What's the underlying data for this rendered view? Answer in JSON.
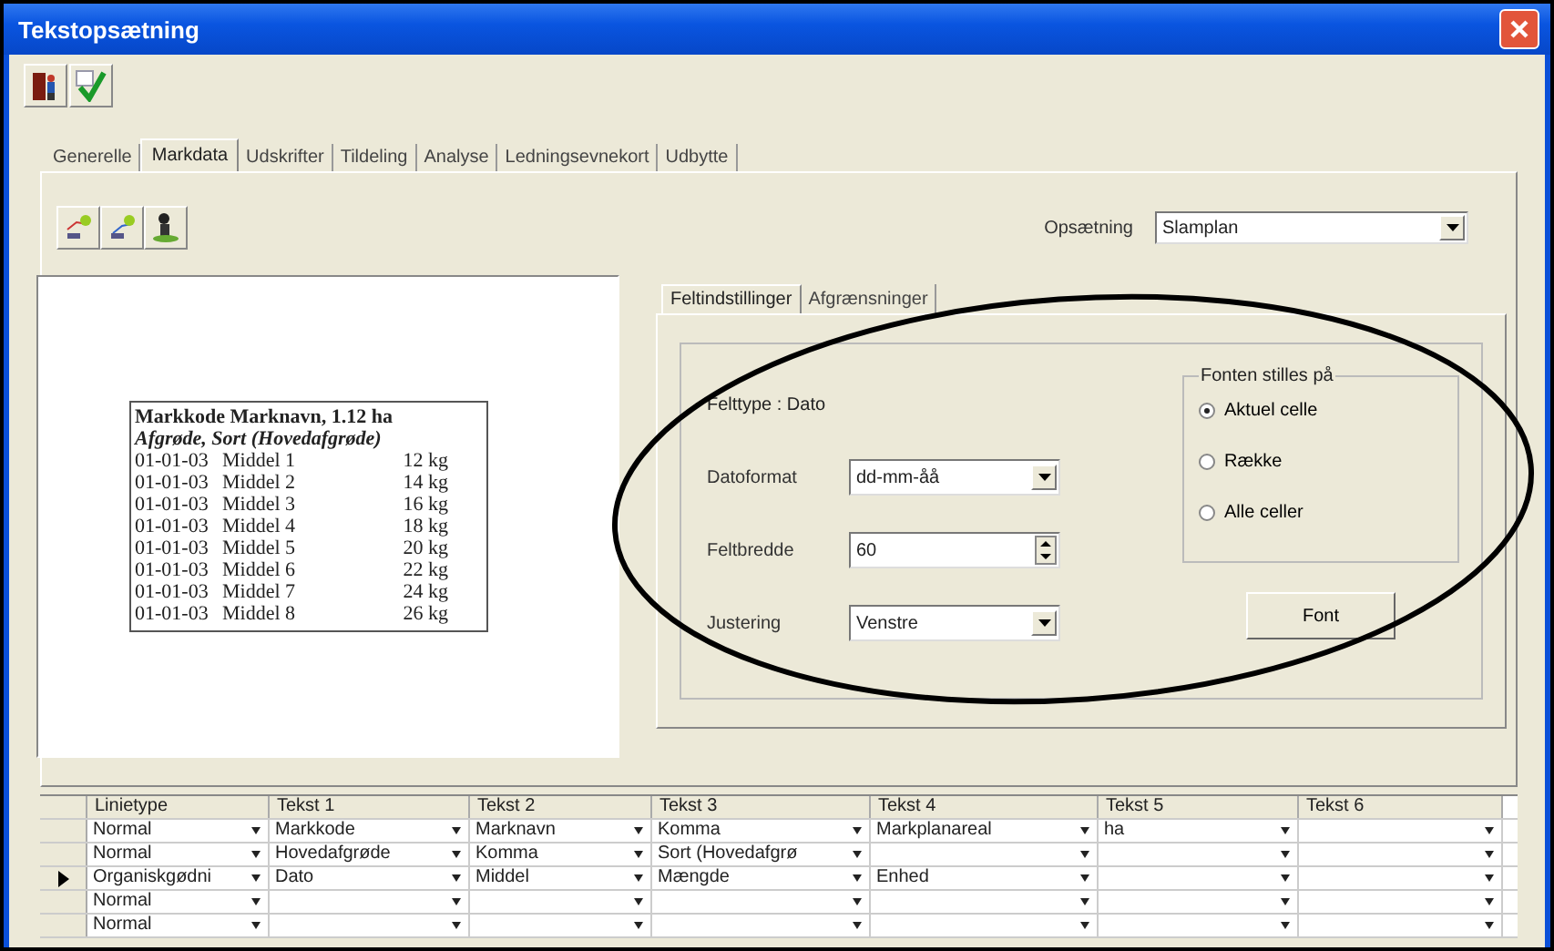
{
  "window": {
    "title": "Tekstopsætning"
  },
  "tabs": [
    {
      "label": "Generelle",
      "selected": false
    },
    {
      "label": "Markdata",
      "selected": true
    },
    {
      "label": "Udskrifter",
      "selected": false
    },
    {
      "label": "Tildeling",
      "selected": false
    },
    {
      "label": "Analyse",
      "selected": false
    },
    {
      "label": "Ledningsevnekort",
      "selected": false
    },
    {
      "label": "Udbytte",
      "selected": false
    }
  ],
  "setup": {
    "label": "Opsætning",
    "value": "Slamplan"
  },
  "preview": {
    "heading": "Markkode Marknavn, 1.12 ha",
    "subheading": "Afgrøde, Sort (Hovedafgrøde)",
    "rows": [
      {
        "date": "01-01-03",
        "name": "Middel 1",
        "amount": "12 kg"
      },
      {
        "date": "01-01-03",
        "name": "Middel 2",
        "amount": "14 kg"
      },
      {
        "date": "01-01-03",
        "name": "Middel 3",
        "amount": "16 kg"
      },
      {
        "date": "01-01-03",
        "name": "Middel 4",
        "amount": "18 kg"
      },
      {
        "date": "01-01-03",
        "name": "Middel 5",
        "amount": "20 kg"
      },
      {
        "date": "01-01-03",
        "name": "Middel 6",
        "amount": "22 kg"
      },
      {
        "date": "01-01-03",
        "name": "Middel 7",
        "amount": "24 kg"
      },
      {
        "date": "01-01-03",
        "name": "Middel 8",
        "amount": "26 kg"
      }
    ]
  },
  "subtabs": [
    {
      "label": "Feltindstillinger",
      "selected": true
    },
    {
      "label": "Afgrænsninger",
      "selected": false
    }
  ],
  "field_settings": {
    "field_type": "Felttype : Dato",
    "fields": [
      {
        "kind": "combo",
        "label": "Datoformat",
        "value": "dd-mm-åå"
      },
      {
        "kind": "spin",
        "label": "Feltbredde",
        "value": "60"
      },
      {
        "kind": "combo",
        "label": "Justering",
        "value": "Venstre"
      }
    ],
    "font_group": {
      "title": "Fonten stilles på",
      "options": [
        {
          "label": "Aktuel celle",
          "selected": true
        },
        {
          "label": "Række",
          "selected": false
        },
        {
          "label": "Alle celler",
          "selected": false
        }
      ]
    },
    "font_button": "Font"
  },
  "grid": {
    "columns": [
      "Linietype",
      "Tekst 1",
      "Tekst 2",
      "Tekst 3",
      "Tekst 4",
      "Tekst 5",
      "Tekst 6"
    ],
    "rows": [
      {
        "current": false,
        "cells": [
          "Normal",
          "Markkode",
          "Marknavn",
          "Komma",
          "Markplanareal",
          "ha",
          ""
        ]
      },
      {
        "current": false,
        "cells": [
          "Normal",
          "Hovedafgrøde",
          "Komma",
          "Sort (Hovedafgrø",
          "",
          "",
          ""
        ]
      },
      {
        "current": true,
        "cells": [
          "Organiskgødni",
          "Dato",
          "Middel",
          "Mængde",
          "Enhed",
          "",
          ""
        ]
      },
      {
        "current": false,
        "cells": [
          "Normal",
          "",
          "",
          "",
          "",
          "",
          ""
        ]
      },
      {
        "current": false,
        "cells": [
          "Normal",
          "",
          "",
          "",
          "",
          "",
          ""
        ]
      }
    ]
  }
}
